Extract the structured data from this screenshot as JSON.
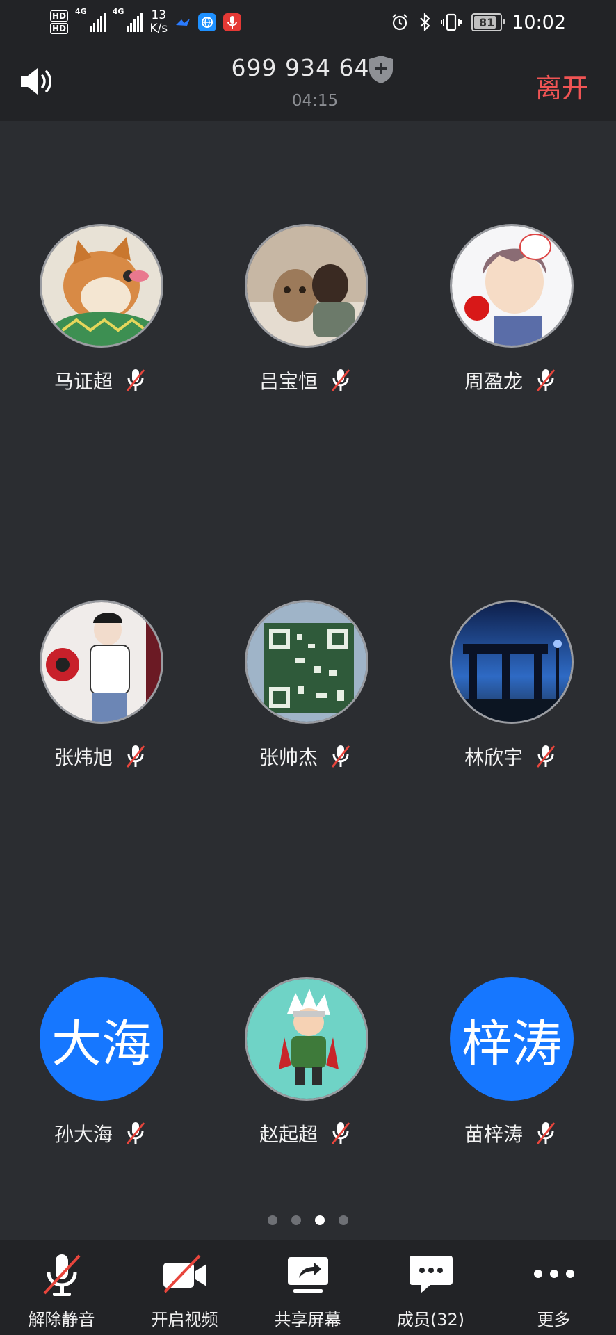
{
  "status_bar": {
    "hd1": "HD",
    "hd2": "HD",
    "net1": "4G",
    "net2": "4G",
    "speed_value": "13",
    "speed_unit": "K/s",
    "battery": "81",
    "time": "10:02"
  },
  "header": {
    "meeting_id": "699 934 644",
    "timer": "04:15",
    "leave_label": "离开"
  },
  "participants": [
    {
      "name": "马证超",
      "avatar_text": "",
      "muted": true
    },
    {
      "name": "吕宝恒",
      "avatar_text": "",
      "muted": true
    },
    {
      "name": "周盈龙",
      "avatar_text": "",
      "muted": true
    },
    {
      "name": "张炜旭",
      "avatar_text": "",
      "muted": true
    },
    {
      "name": "张帅杰",
      "avatar_text": "",
      "muted": true
    },
    {
      "name": "林欣宇",
      "avatar_text": "",
      "muted": true
    },
    {
      "name": "孙大海",
      "avatar_text": "大海",
      "muted": true
    },
    {
      "name": "赵起超",
      "avatar_text": "",
      "muted": true
    },
    {
      "name": "苗梓涛",
      "avatar_text": "梓涛",
      "muted": true
    }
  ],
  "pagination": {
    "total": 4,
    "current": 3
  },
  "toolbar": {
    "unmute_label": "解除静音",
    "video_label": "开启视频",
    "share_label": "共享屏幕",
    "members_label": "成员(32)",
    "more_label": "更多"
  },
  "colors": {
    "background": "#2b2d31",
    "bar": "#222326",
    "leave": "#f05454",
    "avatar_blue": "#1677ff",
    "mute_slash": "#e8453c"
  }
}
